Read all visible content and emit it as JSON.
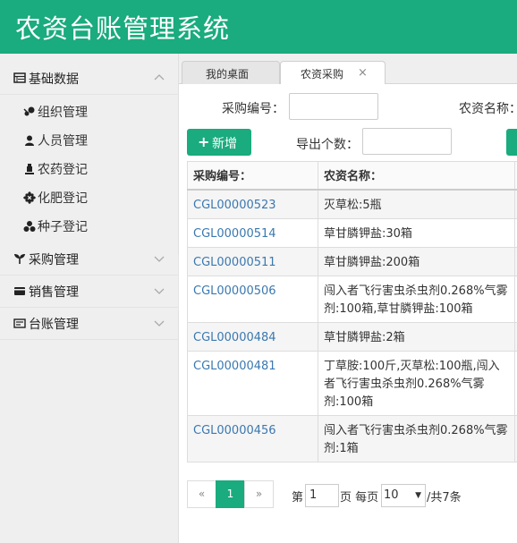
{
  "app": {
    "title": "农资台账管理系统"
  },
  "colors": {
    "brand": "#1aab7e",
    "link": "#3a78b0"
  },
  "sidebar": {
    "groups": [
      {
        "label": "基础数据",
        "icon": "table-icon",
        "expanded": true
      },
      {
        "label": "采购管理",
        "icon": "leaf-icon",
        "expanded": false
      },
      {
        "label": "销售管理",
        "icon": "card-icon",
        "expanded": false
      },
      {
        "label": "台账管理",
        "icon": "ledger-icon",
        "expanded": false
      }
    ],
    "subitems": [
      {
        "label": "组织管理",
        "icon": "organization-icon"
      },
      {
        "label": "人员管理",
        "icon": "person-icon"
      },
      {
        "label": "农药登记",
        "icon": "pesticide-icon"
      },
      {
        "label": "化肥登记",
        "icon": "fertilizer-icon"
      },
      {
        "label": "种子登记",
        "icon": "seed-icon"
      }
    ]
  },
  "tabs": [
    {
      "label": "我的桌面",
      "active": false
    },
    {
      "label": "农资采购",
      "active": true,
      "close": "×"
    }
  ],
  "search": {
    "code_label": "采购编号：",
    "code_value": "",
    "name_label": "农资名称：",
    "export_label": "导出个数：",
    "export_value": ""
  },
  "toolbar": {
    "add_label": "新增",
    "add_icon": "+"
  },
  "table": {
    "headers": [
      "采购编号：",
      "农资名称："
    ],
    "rows": [
      {
        "code": "CGL00000523",
        "name": "灭草松:5瓶"
      },
      {
        "code": "CGL00000514",
        "name": "草甘膦钾盐:30箱"
      },
      {
        "code": "CGL00000511",
        "name": "草甘膦钾盐:200箱"
      },
      {
        "code": "CGL00000506",
        "name": "闯入者飞行害虫杀虫剂0.268%气雾剂:100箱,草甘膦钾盐:100箱"
      },
      {
        "code": "CGL00000484",
        "name": "草甘膦钾盐:2箱"
      },
      {
        "code": "CGL00000481",
        "name": "丁草胺:100斤,灭草松:100瓶,闯入者飞行害虫杀虫剂0.268%气雾剂:100箱"
      },
      {
        "code": "CGL00000456",
        "name": "闯入者飞行害虫杀虫剂0.268%气雾剂:1箱"
      }
    ]
  },
  "pagination": {
    "prev": "«",
    "current": "1",
    "next": "»",
    "page_prefix": "第",
    "page_value": "1",
    "page_suffix": "页 每页",
    "per_page": "10",
    "total_text": "/共7条"
  }
}
